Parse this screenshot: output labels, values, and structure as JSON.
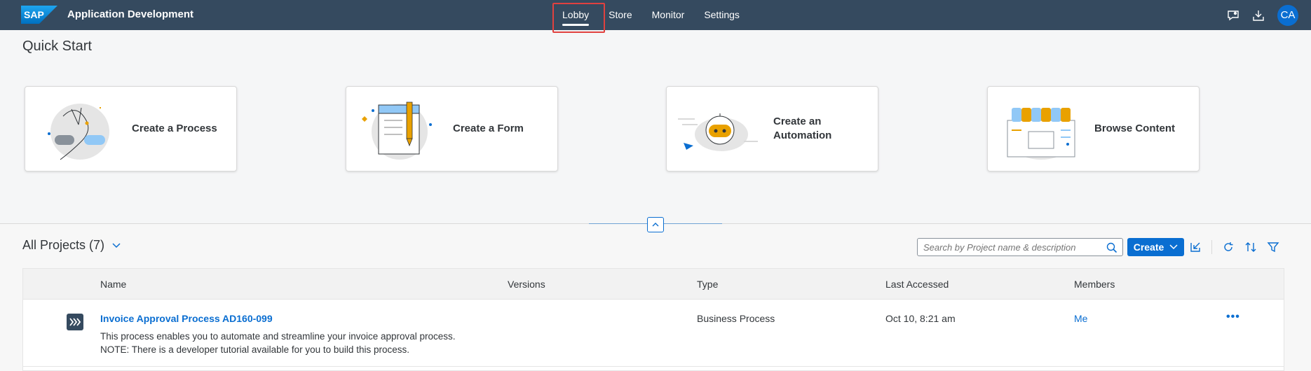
{
  "shell": {
    "app_title": "Application Development",
    "nav": [
      "Lobby",
      "Store",
      "Monitor",
      "Settings"
    ],
    "active_nav": "Lobby",
    "avatar_initials": "CA",
    "icons": [
      "feedback-icon",
      "download-icon"
    ]
  },
  "quick_start": {
    "title": "Quick Start",
    "tiles": [
      {
        "label": "Create a Process",
        "icon": "process-illustration"
      },
      {
        "label": "Create a Form",
        "icon": "form-illustration"
      },
      {
        "label": "Create an Automation",
        "icon": "automation-illustration"
      },
      {
        "label": "Browse Content",
        "icon": "store-illustration"
      }
    ]
  },
  "projects": {
    "title": "All Projects (7)",
    "search_placeholder": "Search by Project name & description",
    "create_label": "Create",
    "columns": [
      "Name",
      "Versions",
      "Type",
      "Last Accessed",
      "Members"
    ],
    "rows": [
      {
        "name": "Invoice Approval Process AD160-099",
        "description_line1": "This process enables you to automate and streamline your invoice approval process.",
        "description_line2": "NOTE: There is a developer tutorial available for you to build this process.",
        "versions": "",
        "type": "Business Process",
        "last_accessed": "Oct 10, 8:21 am",
        "members": "Me",
        "more": "•••"
      }
    ]
  },
  "colors": {
    "shell": "#354a5f",
    "accent": "#0a6ed1",
    "highlight": "#e0413f"
  }
}
